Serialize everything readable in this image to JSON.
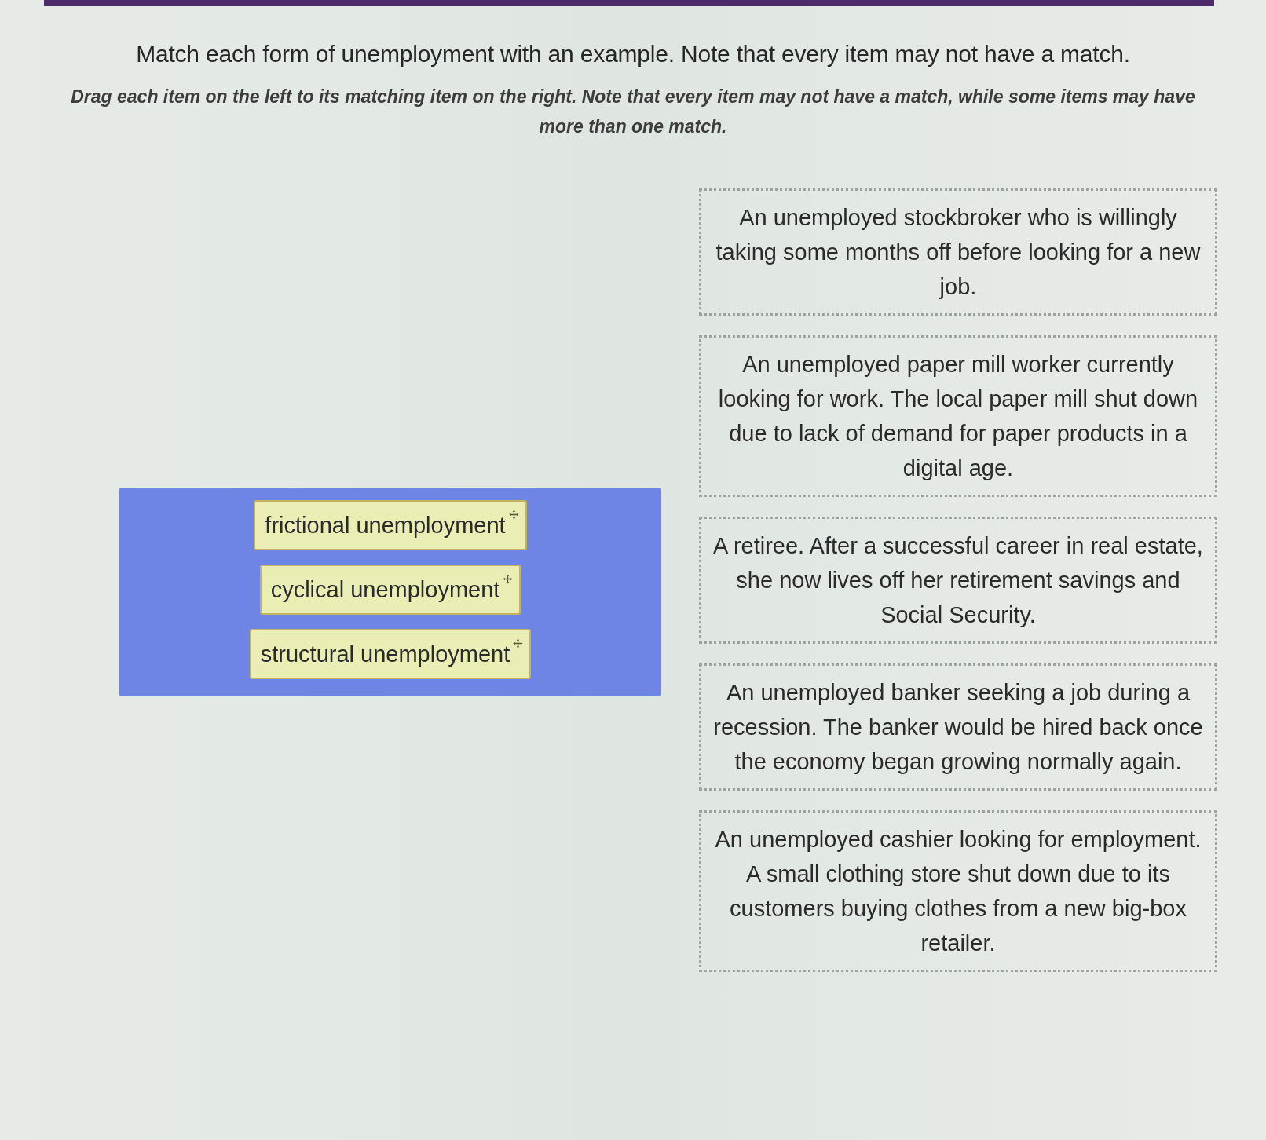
{
  "instructions": {
    "title": "Match each form of unemployment with an example. Note that every item may not have a match.",
    "subtitle": "Drag each item on the left to its matching item on the right. Note that every item may not have a match, while some items may have more than one match."
  },
  "drag_items": [
    {
      "label": "frictional unemployment"
    },
    {
      "label": "cyclical unemployment"
    },
    {
      "label": "structural unemployment"
    }
  ],
  "drop_targets": [
    {
      "text": "An unemployed stockbroker who is willingly taking some months off before looking for a new job."
    },
    {
      "text": "An unemployed paper mill worker currently looking for work. The local paper mill shut down due to lack of demand for paper products in a digital age."
    },
    {
      "text": "A retiree. After a successful career in real estate, she now lives off her retirement savings and Social Security."
    },
    {
      "text": "An unemployed banker seeking a job during a recession. The banker would be hired back once the economy began growing normally again."
    },
    {
      "text": "An unemployed cashier looking for employment. A small clothing store shut down due to its customers buying clothes from a new big-box retailer."
    }
  ]
}
